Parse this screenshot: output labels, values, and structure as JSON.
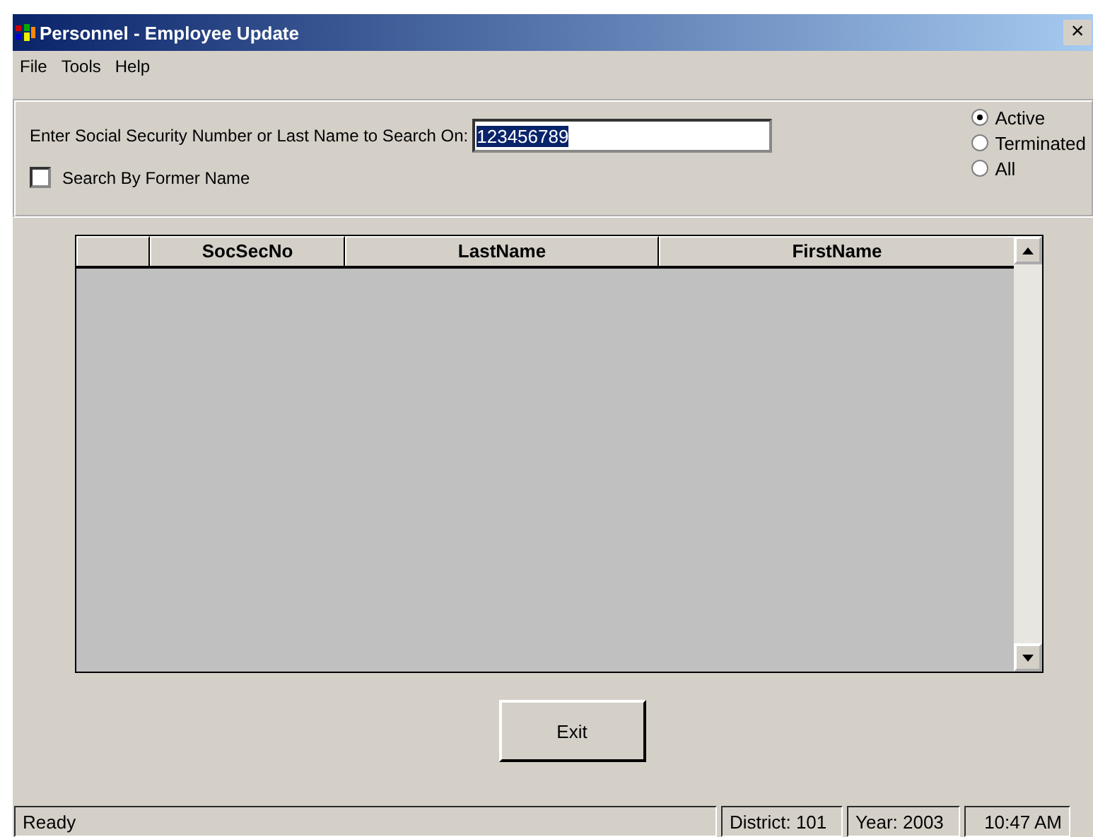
{
  "window": {
    "title": "Personnel - Employee Update",
    "close": "×"
  },
  "menu": [
    {
      "label": "File"
    },
    {
      "label": "Tools"
    },
    {
      "label": "Help"
    }
  ],
  "search": {
    "label": "Enter Social Security Number  or Last Name to Search On:",
    "value": "123456789",
    "former_name": {
      "label": "Search By Former Name",
      "checked": false
    }
  },
  "status_filter": [
    {
      "label": "Active",
      "selected": true
    },
    {
      "label": "Terminated",
      "selected": false
    },
    {
      "label": "All",
      "selected": false
    }
  ],
  "table": {
    "columns": [
      "SocSecNo",
      "LastName",
      "FirstName"
    ]
  },
  "exit_button": {
    "label": "Exit"
  },
  "status_bar": [
    "Ready",
    "District: 101",
    "Year: 2003",
    "10:47 AM"
  ]
}
